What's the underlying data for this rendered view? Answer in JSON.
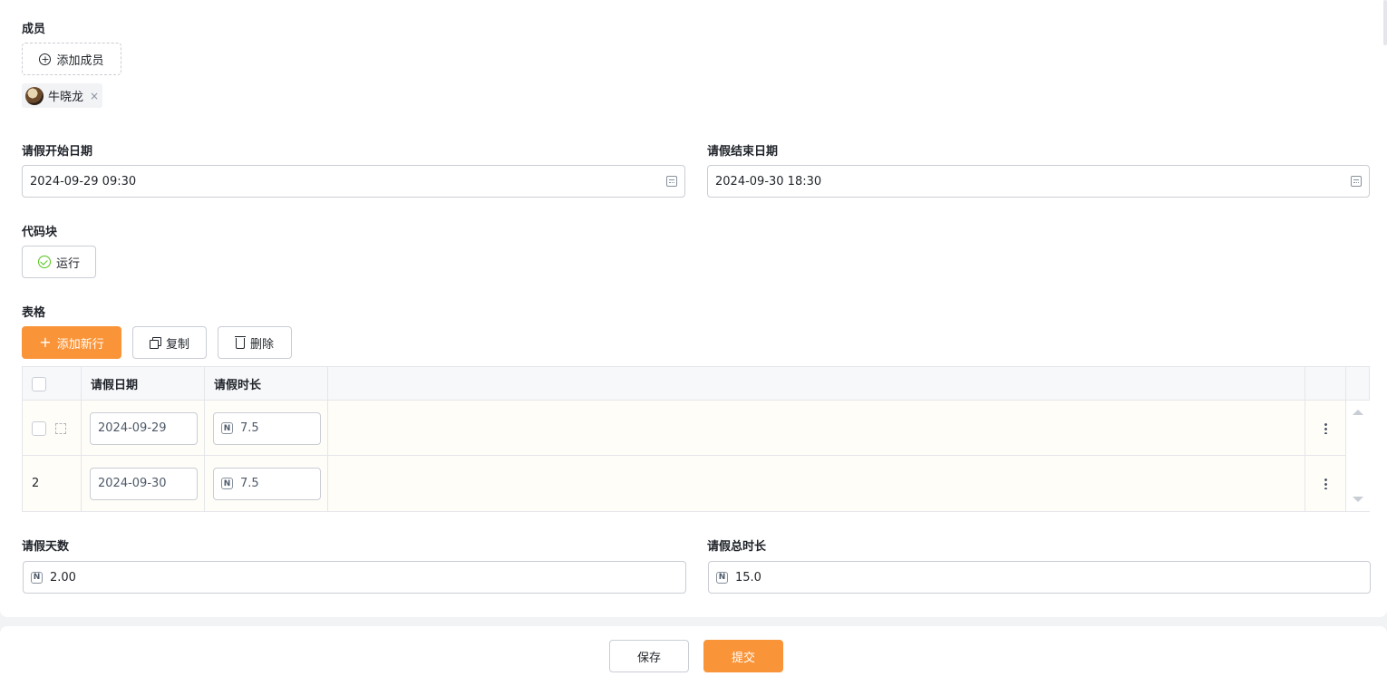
{
  "members": {
    "label": "成员",
    "add_button": "添加成员",
    "chips": [
      {
        "name": "牛晓龙",
        "close": "×"
      }
    ]
  },
  "leave_start": {
    "label": "请假开始日期",
    "value": "2024-09-29 09:30"
  },
  "leave_end": {
    "label": "请假结束日期",
    "value": "2024-09-30 18:30"
  },
  "code_block": {
    "label": "代码块",
    "run_button": "运行"
  },
  "table_section": {
    "label": "表格",
    "add_row_button": "添加新行",
    "copy_button": "复制",
    "delete_button": "删除",
    "columns": [
      "请假日期",
      "请假时长"
    ],
    "rows": [
      {
        "index": "",
        "date": "2024-09-29",
        "duration": "7.5"
      },
      {
        "index": "2",
        "date": "2024-09-30",
        "duration": "7.5"
      }
    ]
  },
  "leave_days": {
    "label": "请假天数",
    "value": "2.00"
  },
  "leave_total": {
    "label": "请假总时长",
    "value": "15.0"
  },
  "footer": {
    "save": "保存",
    "submit": "提交"
  },
  "colors": {
    "primary": "#fa9438",
    "success": "#52c41a"
  },
  "icons": {
    "number": "N"
  }
}
